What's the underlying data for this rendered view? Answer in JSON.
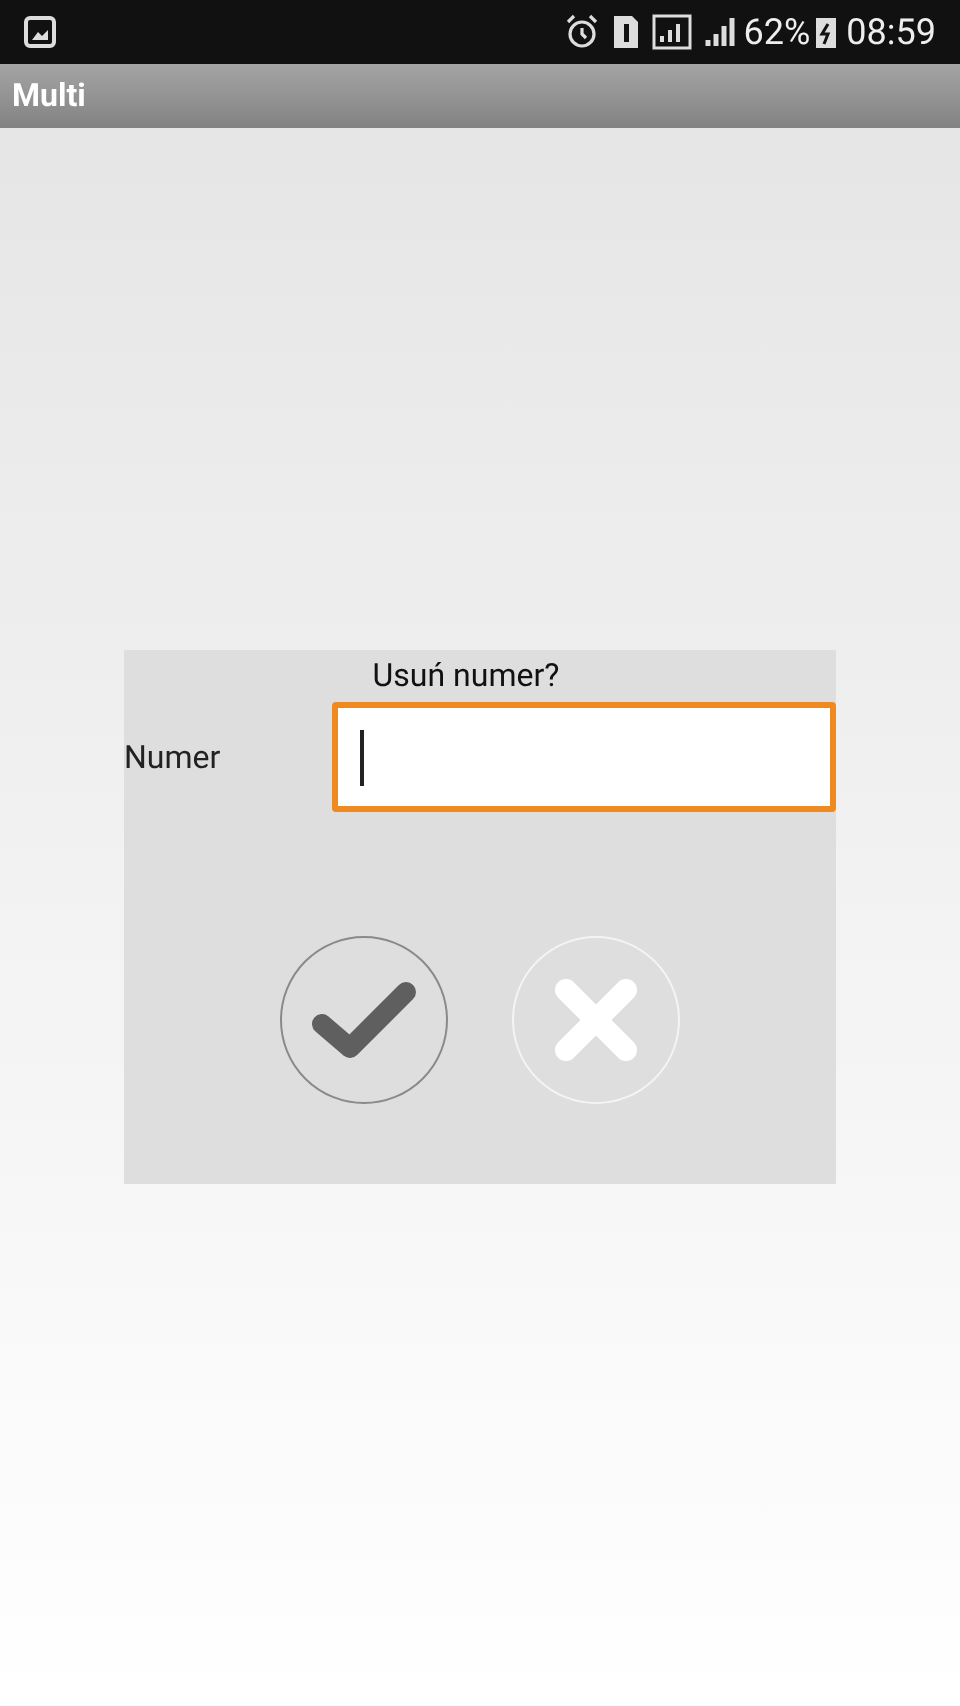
{
  "status_bar": {
    "battery": "62%",
    "time": "08:59"
  },
  "app_bar": {
    "title": "Multi"
  },
  "dialog": {
    "title": "Usuń numer?",
    "field": {
      "label": "Numer",
      "focused": true
    },
    "buttons": [
      {
        "kind": "confirm"
      },
      {
        "kind": "cancel"
      }
    ]
  }
}
